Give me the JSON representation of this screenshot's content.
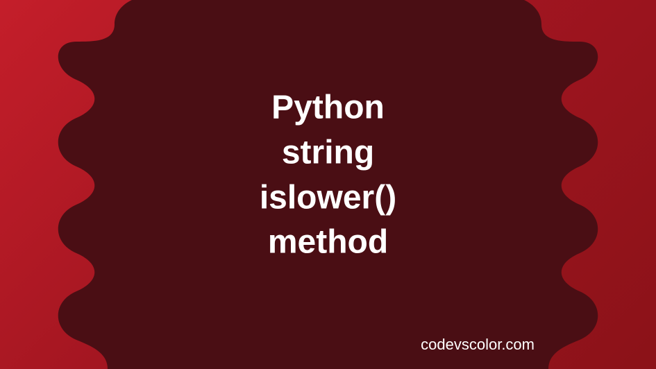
{
  "title": {
    "line1": "Python",
    "line2": "string",
    "line3": "islower()",
    "line4": "method"
  },
  "website": "codevscolor.com",
  "colors": {
    "bg_gradient_start": "#c41e2a",
    "bg_gradient_end": "#8b1218",
    "blob": "#4a0e14",
    "text": "#ffffff"
  }
}
